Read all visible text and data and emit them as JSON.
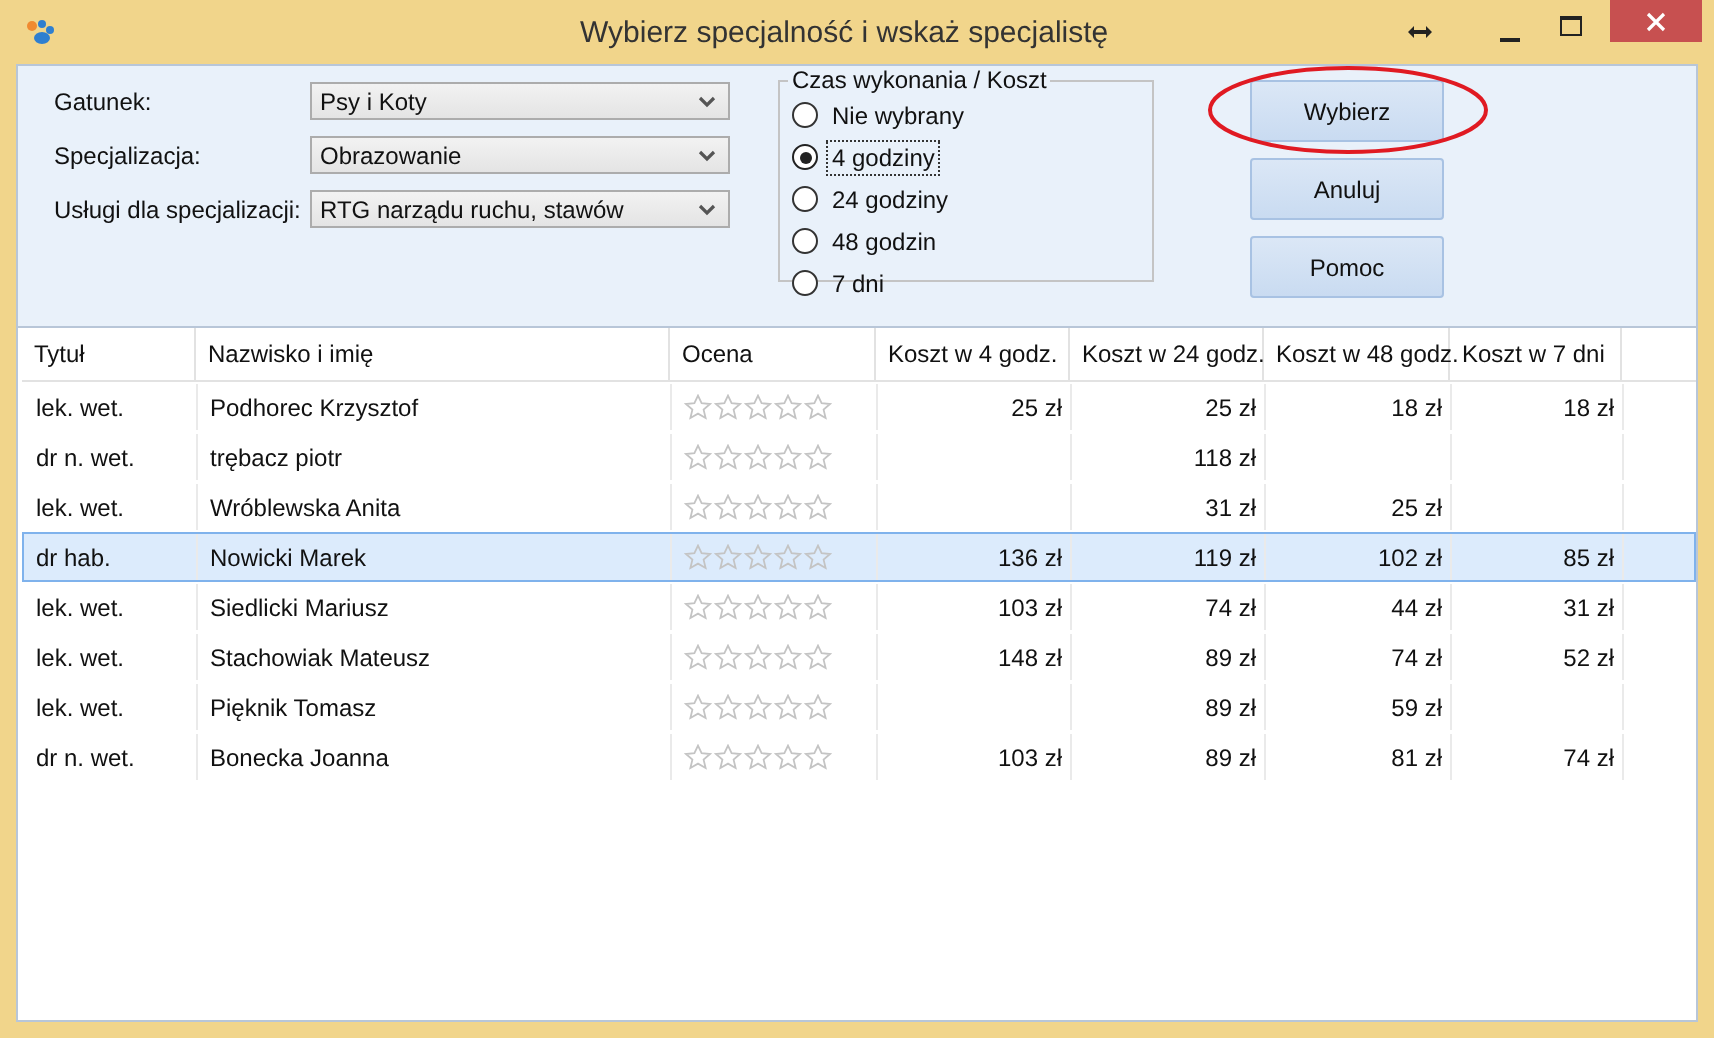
{
  "window": {
    "title": "Wybierz specjalność i wskaż specjalistę"
  },
  "form": [
    {
      "label": "Gatunek:",
      "value": "Psy i Koty"
    },
    {
      "label": "Specjalizacja:",
      "value": "Obrazowanie"
    },
    {
      "label": "Usługi dla specjalizacji:",
      "value": "RTG narządu ruchu, stawów"
    }
  ],
  "time_group": {
    "title": "Czas wykonania / Koszt",
    "options": [
      {
        "label": "Nie wybrany",
        "selected": false
      },
      {
        "label": "4 godziny",
        "selected": true
      },
      {
        "label": "24 godziny",
        "selected": false
      },
      {
        "label": "48 godzin",
        "selected": false
      },
      {
        "label": "7 dni",
        "selected": false
      }
    ]
  },
  "buttons": [
    {
      "label": "Wybierz",
      "circled": true
    },
    {
      "label": "Anuluj",
      "circled": false
    },
    {
      "label": "Pomoc",
      "circled": false
    }
  ],
  "table": {
    "columns": [
      "Tytuł",
      "Nazwisko i imię",
      "Ocena",
      "Koszt w 4 godz.",
      "Koszt w 24 godz.",
      "Koszt w 48 godz.",
      "Koszt w 7 dni"
    ],
    "rows": [
      {
        "title": "lek. wet.",
        "name": "Podhorec Krzysztof",
        "stars": 0,
        "cost_4h": "25 zł",
        "cost_24h": "25 zł",
        "cost_48h": "18 zł",
        "cost_7d": "18 zł",
        "selected": false
      },
      {
        "title": "dr n. wet.",
        "name": "trębacz piotr",
        "stars": 0,
        "cost_24h": "118 zł",
        "selected": false
      },
      {
        "title": "lek. wet.",
        "name": "Wróblewska Anita",
        "stars": 0,
        "cost_24h": "31 zł",
        "cost_48h": "25 zł",
        "selected": false
      },
      {
        "title": "dr hab.",
        "name": "Nowicki Marek",
        "stars": 0,
        "cost_4h": "136 zł",
        "cost_24h": "119 zł",
        "cost_48h": "102 zł",
        "cost_7d": "85 zł",
        "selected": true
      },
      {
        "title": "lek. wet.",
        "name": "Siedlicki Mariusz",
        "stars": 0,
        "cost_4h": "103 zł",
        "cost_24h": "74 zł",
        "cost_48h": "44 zł",
        "cost_7d": "31 zł",
        "selected": false
      },
      {
        "title": "lek. wet.",
        "name": "Stachowiak Mateusz",
        "stars": 0,
        "cost_4h": "148 zł",
        "cost_24h": "89 zł",
        "cost_48h": "74 zł",
        "cost_7d": "52 zł",
        "selected": false
      },
      {
        "title": "lek. wet.",
        "name": "Pięknik Tomasz",
        "stars": 0,
        "cost_24h": "89 zł",
        "cost_48h": "59 zł",
        "selected": false
      },
      {
        "title": "dr n. wet.",
        "name": "Bonecka Joanna",
        "stars": 0,
        "cost_4h": "103 zł",
        "cost_24h": "89 zł",
        "cost_48h": "81 zł",
        "cost_7d": "74 zł",
        "selected": false
      }
    ]
  }
}
